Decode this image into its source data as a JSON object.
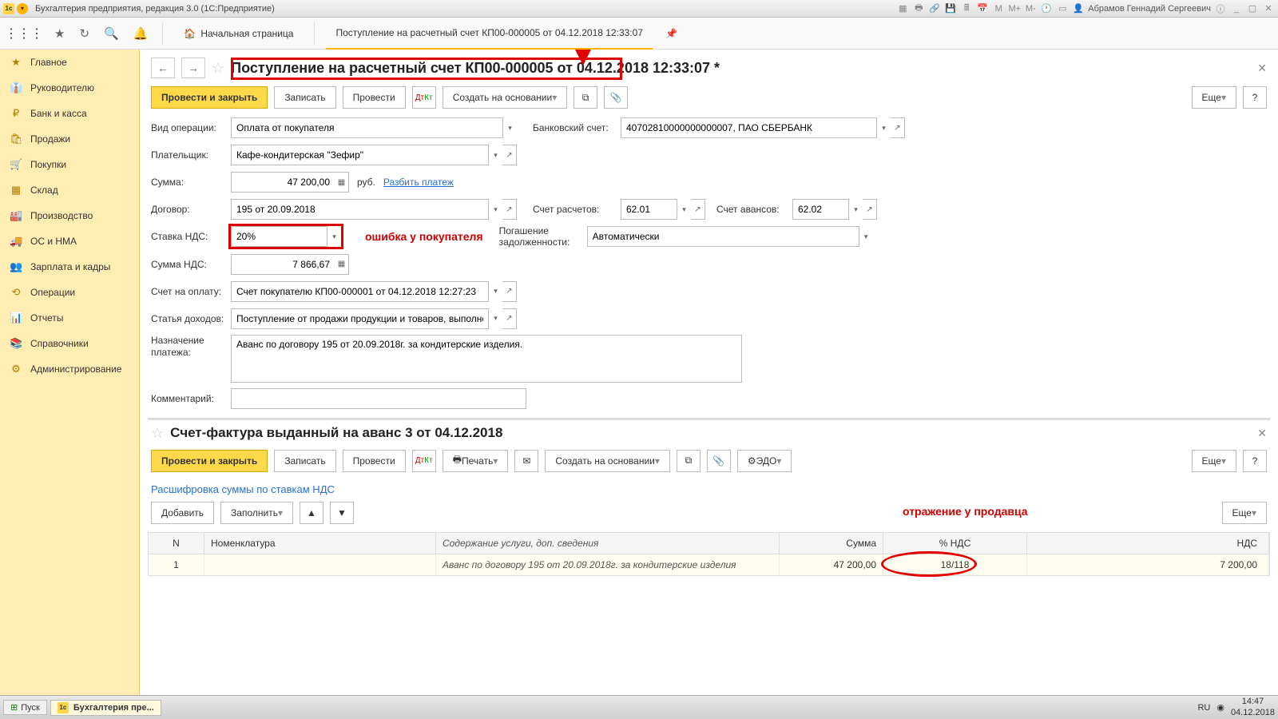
{
  "titlebar": {
    "text": "Бухгалтерия предприятия, редакция 3.0  (1С:Предприятие)",
    "user": "Абрамов Геннадий Сергеевич"
  },
  "toolbar": {
    "home": "Начальная страница",
    "tab1": "Поступление на расчетный счет КП00-000005 от 04.12.2018 12:33:07"
  },
  "sidebar": {
    "items": [
      {
        "icon": "★",
        "label": "Главное"
      },
      {
        "icon": "👔",
        "label": "Руководителю"
      },
      {
        "icon": "₽",
        "label": "Банк и касса"
      },
      {
        "icon": "🛍",
        "label": "Продажи"
      },
      {
        "icon": "🛒",
        "label": "Покупки"
      },
      {
        "icon": "▦",
        "label": "Склад"
      },
      {
        "icon": "🏭",
        "label": "Производство"
      },
      {
        "icon": "🚚",
        "label": "ОС и НМА"
      },
      {
        "icon": "👥",
        "label": "Зарплата и кадры"
      },
      {
        "icon": "⟲",
        "label": "Операции"
      },
      {
        "icon": "📊",
        "label": "Отчеты"
      },
      {
        "icon": "📚",
        "label": "Справочники"
      },
      {
        "icon": "⚙",
        "label": "Администрирование"
      }
    ]
  },
  "doc1": {
    "title": "Поступление на расчетный счет КП00-000005 от 04.12.2018 12:33:07 *",
    "btn_post_close": "Провести и закрыть",
    "btn_save": "Записать",
    "btn_post": "Провести",
    "btn_create": "Создать на основании",
    "btn_more": "Еще",
    "labels": {
      "op_type": "Вид операции:",
      "payer": "Плательщик:",
      "sum": "Сумма:",
      "contract": "Договор:",
      "vat_rate": "Ставка НДС:",
      "vat_sum": "Сумма НДС:",
      "invoice": "Счет на оплату:",
      "income_item": "Статья доходов:",
      "purpose": "Назначение платежа:",
      "comment": "Комментарий:",
      "bank_acc": "Банковский счет:",
      "settle_acc": "Счет расчетов:",
      "advance_acc": "Счет авансов:",
      "debt": "Погашение задолженности:"
    },
    "values": {
      "op_type": "Оплата от покупателя",
      "payer": "Кафе-кондитерская \"Зефир\"",
      "sum": "47 200,00",
      "currency": "руб.",
      "split": "Разбить платеж",
      "contract": "195 от 20.09.2018",
      "vat_rate": "20%",
      "vat_sum": "7 866,67",
      "invoice": "Счет покупателю КП00-000001 от 04.12.2018 12:27:23",
      "income_item": "Поступление от продажи продукции и товаров, выполнения",
      "purpose": "Аванс по договору 195 от 20.09.2018г. за кондитерские изделия.",
      "bank_acc": "40702810000000000007, ПАО СБЕРБАНК",
      "settle_acc": "62.01",
      "advance_acc": "62.02",
      "debt": "Автоматически"
    },
    "annotation": "ошибка у покупателя"
  },
  "doc2": {
    "title": "Счет-фактура выданный на аванс 3 от 04.12.2018",
    "btn_post_close": "Провести и закрыть",
    "btn_save": "Записать",
    "btn_post": "Провести",
    "btn_print": "Печать",
    "btn_create": "Создать на основании",
    "btn_edo": "ЭДО",
    "btn_more": "Еще",
    "subtext": "Расшифровка суммы по ставкам НДС",
    "btn_add": "Добавить",
    "btn_fill": "Заполнить",
    "cols": {
      "n": "N",
      "nom": "Номенклатура",
      "desc": "Содержание услуги, доп. сведения",
      "sum": "Сумма",
      "vat": "% НДС",
      "nds": "НДС"
    },
    "row": {
      "n": "1",
      "desc": "Аванс по договору 195 от 20.09.2018г. за кондитерские изделия",
      "sum": "47 200,00",
      "vat": "18/118",
      "nds": "7 200,00"
    },
    "annotation": "отражение у продавца"
  },
  "taskbar": {
    "start": "Пуск",
    "task": "Бухгалтерия пре...",
    "lang": "RU",
    "time": "14:47",
    "date": "04.12.2018"
  }
}
